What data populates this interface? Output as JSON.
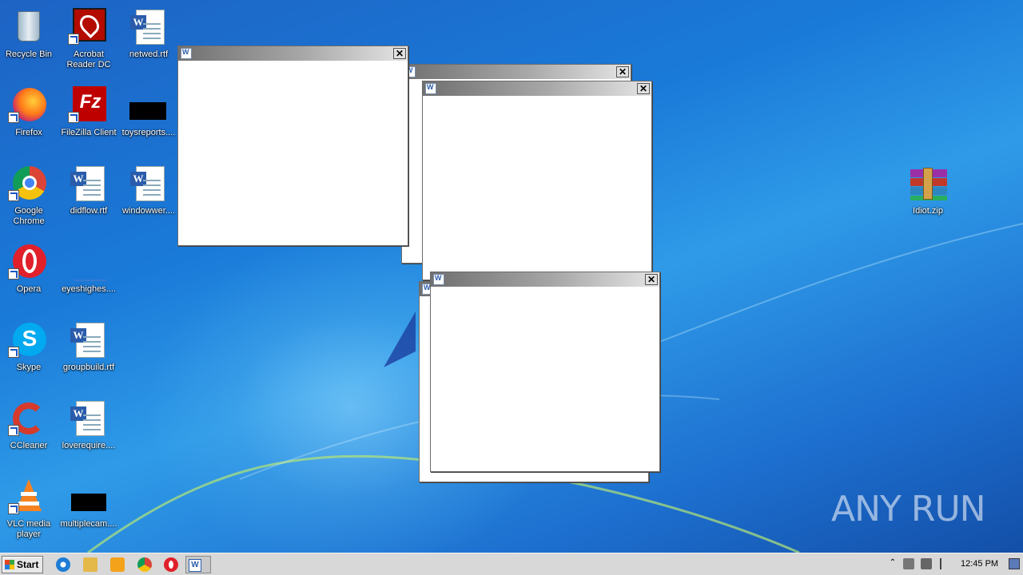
{
  "desktop_icons": [
    {
      "label": "Recycle Bin",
      "icon": "recycle-bin-icon"
    },
    {
      "label": "Acrobat Reader DC",
      "icon": "acrobat-icon"
    },
    {
      "label": "netwed.rtf",
      "icon": "word-document-icon"
    },
    {
      "label": "Firefox",
      "icon": "firefox-icon"
    },
    {
      "label": "FileZilla Client",
      "icon": "filezilla-icon"
    },
    {
      "label": "toysreports....",
      "icon": "redacted-file-icon"
    },
    {
      "label": "Google Chrome",
      "icon": "chrome-icon"
    },
    {
      "label": "didflow.rtf",
      "icon": "word-document-icon"
    },
    {
      "label": "windowwer....",
      "icon": "word-document-icon"
    },
    {
      "label": "Opera",
      "icon": "opera-icon"
    },
    {
      "label": "eyeshighes....",
      "icon": "blank-file-icon"
    },
    {
      "label": "Skype",
      "icon": "skype-icon"
    },
    {
      "label": "groupbuild.rtf",
      "icon": "word-document-icon"
    },
    {
      "label": "CCleaner",
      "icon": "ccleaner-icon"
    },
    {
      "label": "loverequire....",
      "icon": "word-document-icon"
    },
    {
      "label": "VLC media player",
      "icon": "vlc-icon"
    },
    {
      "label": "multiplecam....",
      "icon": "redacted-file-icon"
    },
    {
      "label": "Idiot.zip",
      "icon": "winrar-archive-icon"
    }
  ],
  "windows": [
    {
      "title": "",
      "close": "✕"
    },
    {
      "title": "",
      "close": "✕"
    },
    {
      "title": "",
      "close": "✕"
    },
    {
      "title": "",
      "close": "✕"
    }
  ],
  "taskbar": {
    "start_label": "Start",
    "pinned": [
      "internet-explorer-icon",
      "file-explorer-icon",
      "media-player-icon",
      "chrome-icon",
      "opera-icon"
    ],
    "active_task_icon": "word-icon",
    "clock": "12:45 PM"
  },
  "watermark": "ANY RUN",
  "colors": {
    "desktop_blue": "#1a7ad8",
    "taskbar": "#d8d8d8",
    "titlebar_dark": "#707070",
    "titlebar_light": "#e6e6e6"
  }
}
